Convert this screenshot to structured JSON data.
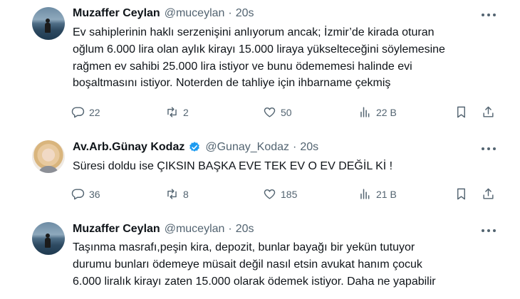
{
  "tweets": [
    {
      "name": "Muzaffer Ceylan",
      "handle": "@muceylan",
      "dot": "·",
      "time": "20s",
      "lines": [
        "Ev sahiplerinin haklı serzenişini anlıyorum ancak; İzmir’de kirada oturan",
        "oğlum 6.000 lira olan aylık kirayı 15.000 liraya yükselteceğini söylemesine",
        "rağmen ev sahibi 25.000 lira istiyor ve bunu ödememesi halinde evi",
        "boşaltmasını istiyor. Noterden de tahliye için ihbarname çekmiş"
      ],
      "replies": "22",
      "reposts": "2",
      "likes": "50",
      "views": "22 B"
    },
    {
      "name": "Av.Arb.Günay Kodaz",
      "handle": "@Gunay_Kodaz",
      "dot": "·",
      "time": "20s",
      "verified_color": "#1d9bf0",
      "lines": [
        "Süresi doldu ise ÇIKSIN BAŞKA EVE TEK EV O EV DEĞİL Kİ !"
      ],
      "replies": "36",
      "reposts": "8",
      "likes": "185",
      "views": "21 B"
    },
    {
      "name": "Muzaffer Ceylan",
      "handle": "@muceylan",
      "dot": "·",
      "time": "20s",
      "lines": [
        "Taşınma masrafı,peşin kira, depozit, bunlar bayağı bir yekün tutuyor",
        "durumu bunları ödemeye müsait değil nasıl etsin avukat hanım çocuk",
        "6.000 liralık kirayı zaten 15.000 olarak ödemek istiyor. Daha ne yapabilir"
      ]
    }
  ],
  "icons": {
    "reply": "reply-icon",
    "repost": "repost-icon",
    "like": "like-icon",
    "views": "views-icon",
    "bookmark": "bookmark-icon",
    "share": "share-icon",
    "more": "more-icon",
    "verified": "verified-badge-icon"
  },
  "colors": {
    "text": "#0f1419",
    "secondary": "#536471",
    "verified": "#1d9bf0"
  }
}
